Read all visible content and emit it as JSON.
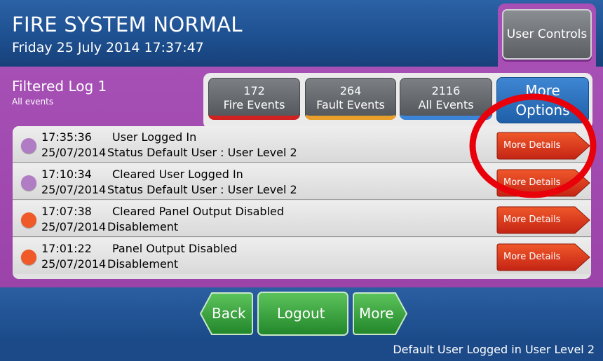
{
  "header": {
    "title": "FIRE SYSTEM NORMAL",
    "datetime": "Friday 25 July 2014 17:37:47",
    "user_controls_label": "User Controls"
  },
  "log": {
    "title": "Filtered Log 1",
    "subtitle": "All events"
  },
  "filters": [
    {
      "count": "172",
      "label": "Fire Events",
      "color": "#d12222"
    },
    {
      "count": "264",
      "label": "Fault Events",
      "color": "#e8a02a"
    },
    {
      "count": "2116",
      "label": "All Events",
      "color": "#3c84d8"
    }
  ],
  "more_options": {
    "line1": "More",
    "line2": "Options"
  },
  "events": [
    {
      "time": "17:35:36",
      "event": "User Logged In",
      "date": "25/07/2014",
      "category": "Status Default User : User Level 2",
      "dot_color": "#b07cc4",
      "action": "More Details"
    },
    {
      "time": "17:10:34",
      "event": "Cleared User Logged In",
      "date": "25/07/2014",
      "category": "Status Default User : User Level 2",
      "dot_color": "#b07cc4",
      "action": "More Details"
    },
    {
      "time": "17:07:38",
      "event": "Cleared Panel Output Disabled",
      "date": "25/07/2014",
      "category": "Disablement",
      "dot_color": "#ef5a28",
      "action": "More Details"
    },
    {
      "time": "17:01:22",
      "event": "Panel Output Disabled",
      "date": "25/07/2014",
      "category": "Disablement",
      "dot_color": "#ef5a28",
      "action": "More Details"
    }
  ],
  "nav": {
    "back": "Back",
    "logout": "Logout",
    "more": "More"
  },
  "status": {
    "text": "Default User Logged in User Level 2"
  },
  "colors": {
    "header_blue": "#1d4f8f",
    "panel_purple": "#a64fb5",
    "button_green": "#34a63a",
    "details_red": "#d6331e",
    "annotation_red": "#e8000a"
  }
}
